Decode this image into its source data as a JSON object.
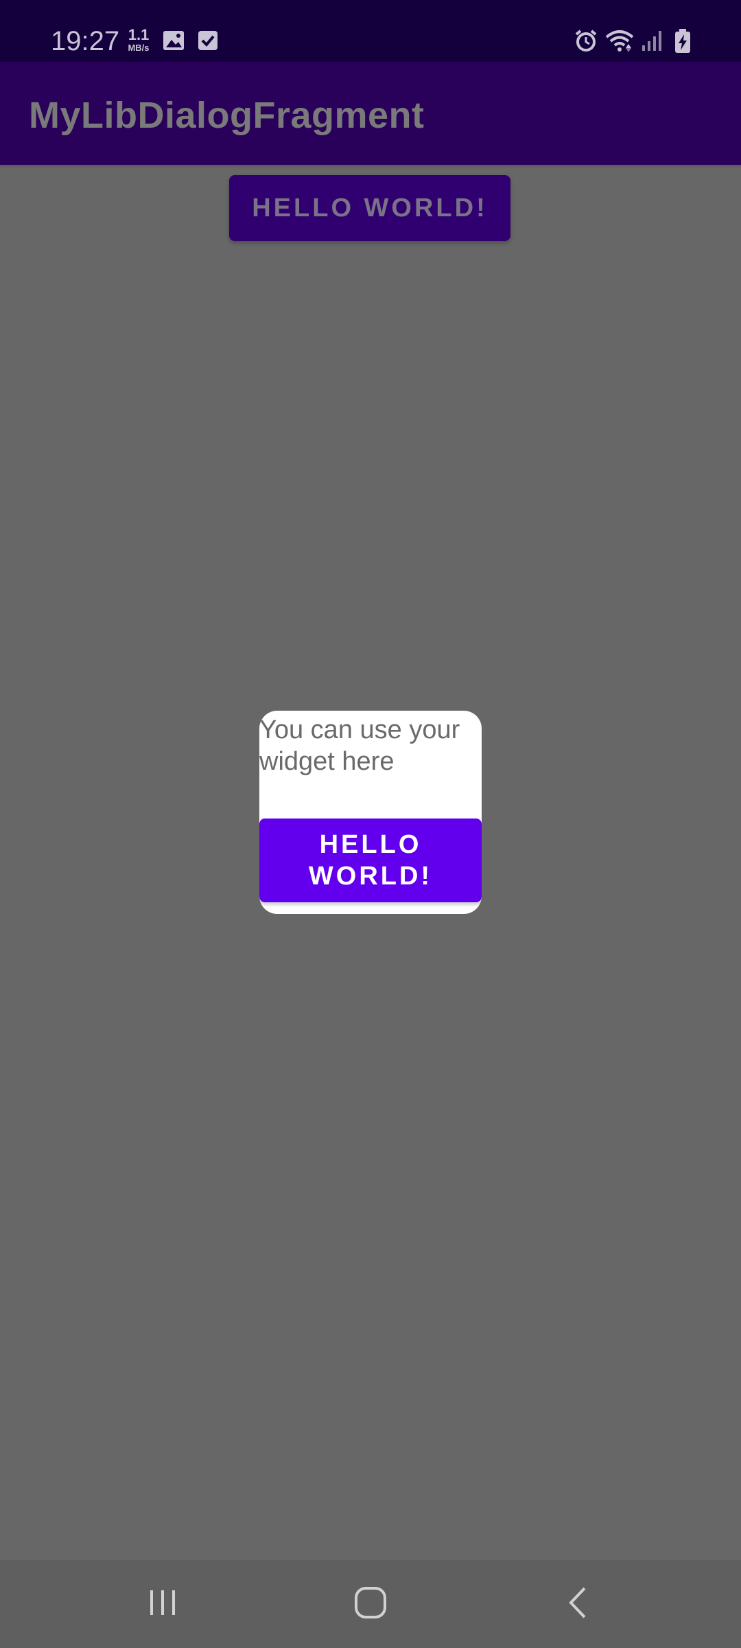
{
  "status_bar": {
    "time": "19:27",
    "speed_value": "1.1",
    "speed_unit": "MB/s",
    "icons": [
      "image-icon",
      "checkbox-icon",
      "alarm-icon",
      "wifi-icon",
      "signal-icon",
      "battery-charging-icon"
    ]
  },
  "app_bar": {
    "title": "MyLibDialogFragment"
  },
  "main": {
    "button_label": "HELLO WORLD!"
  },
  "dialog": {
    "message": "You can use your widget here",
    "button_label": "HELLO WORLD!"
  },
  "nav_bar": {
    "icons": [
      "recent-apps-icon",
      "home-icon",
      "back-icon"
    ]
  },
  "colors": {
    "status_bar": "#14003d",
    "app_bar": "#29005a",
    "scrim_background": "#676767",
    "accent": "#6200ee",
    "dialog_background": "#ffffff"
  }
}
